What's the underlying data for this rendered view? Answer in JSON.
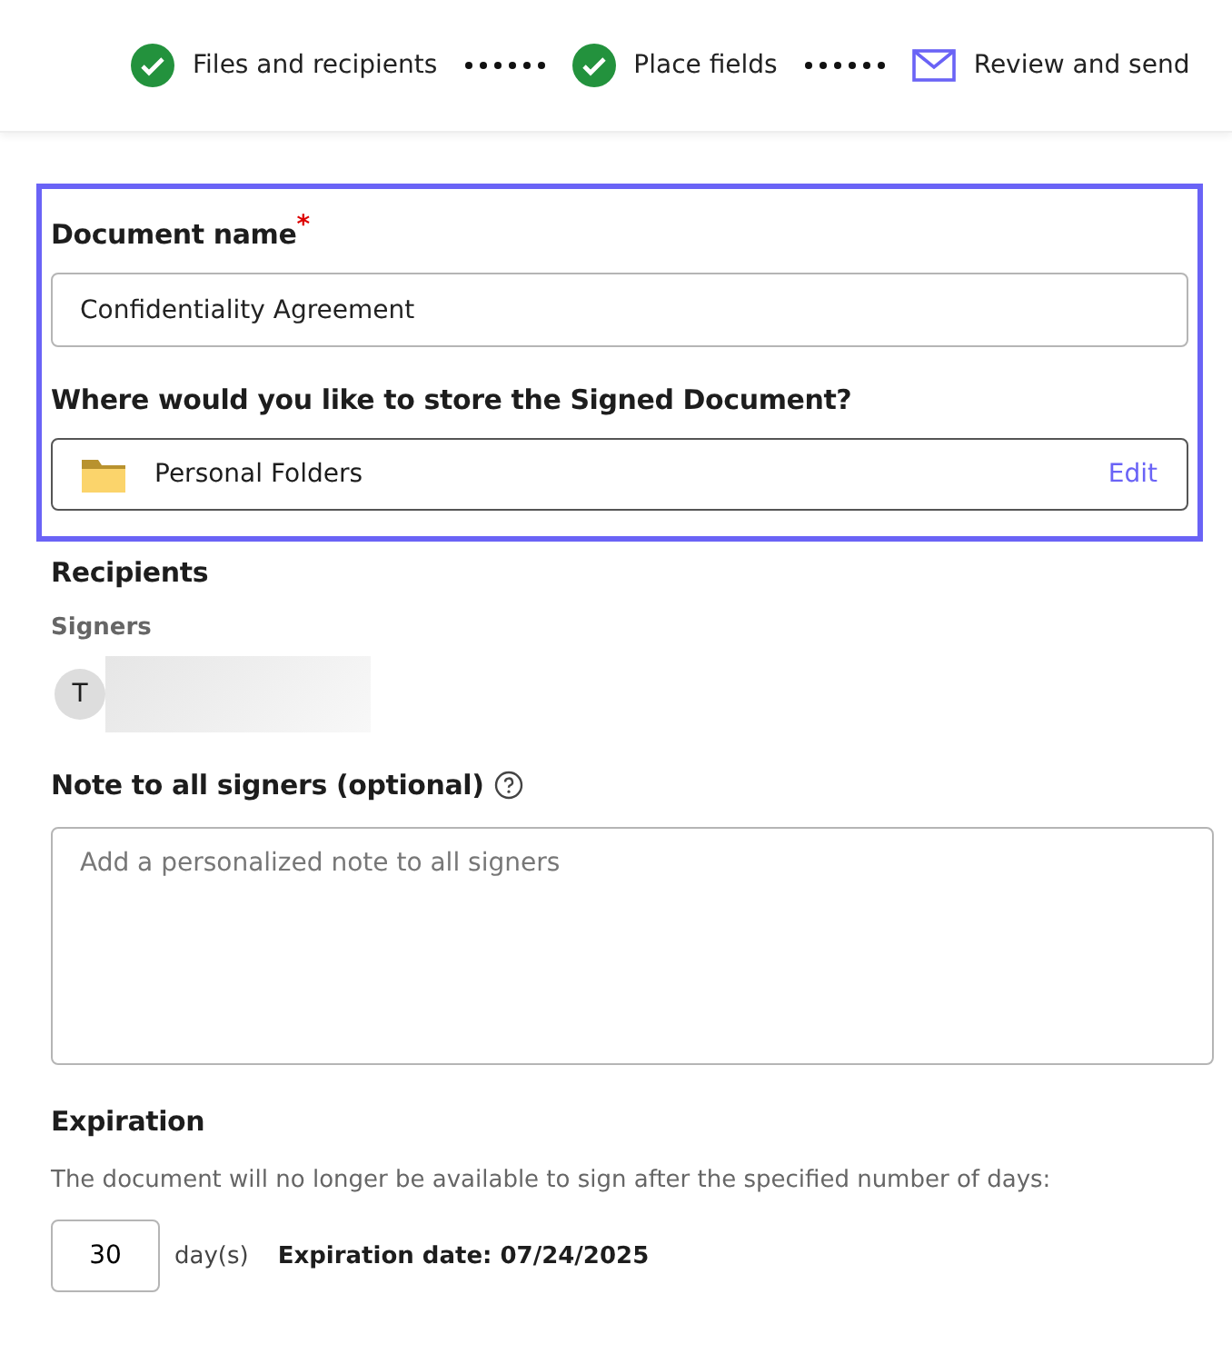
{
  "steps": [
    {
      "label": "Files and recipients",
      "kind": "done"
    },
    {
      "label": "Place fields",
      "kind": "done"
    },
    {
      "label": "Review and send",
      "kind": "current"
    }
  ],
  "document_name": {
    "label": "Document name",
    "required_mark": "*",
    "value": "Confidentiality Agreement"
  },
  "storage": {
    "label": "Where would you like to store the Signed Document?",
    "folder": "Personal Folders",
    "action": "Edit"
  },
  "recipients": {
    "title": "Recipients",
    "group": "Signers",
    "signers": [
      {
        "initial": "T"
      }
    ]
  },
  "note": {
    "label": "Note to all signers (optional)",
    "placeholder": "Add a personalized note to all signers"
  },
  "expiration": {
    "title": "Expiration",
    "description": "The document will no longer be available to sign after the specified number of days:",
    "days": "30",
    "unit": "day(s)",
    "date": "Expiration date: 07/24/2025"
  }
}
